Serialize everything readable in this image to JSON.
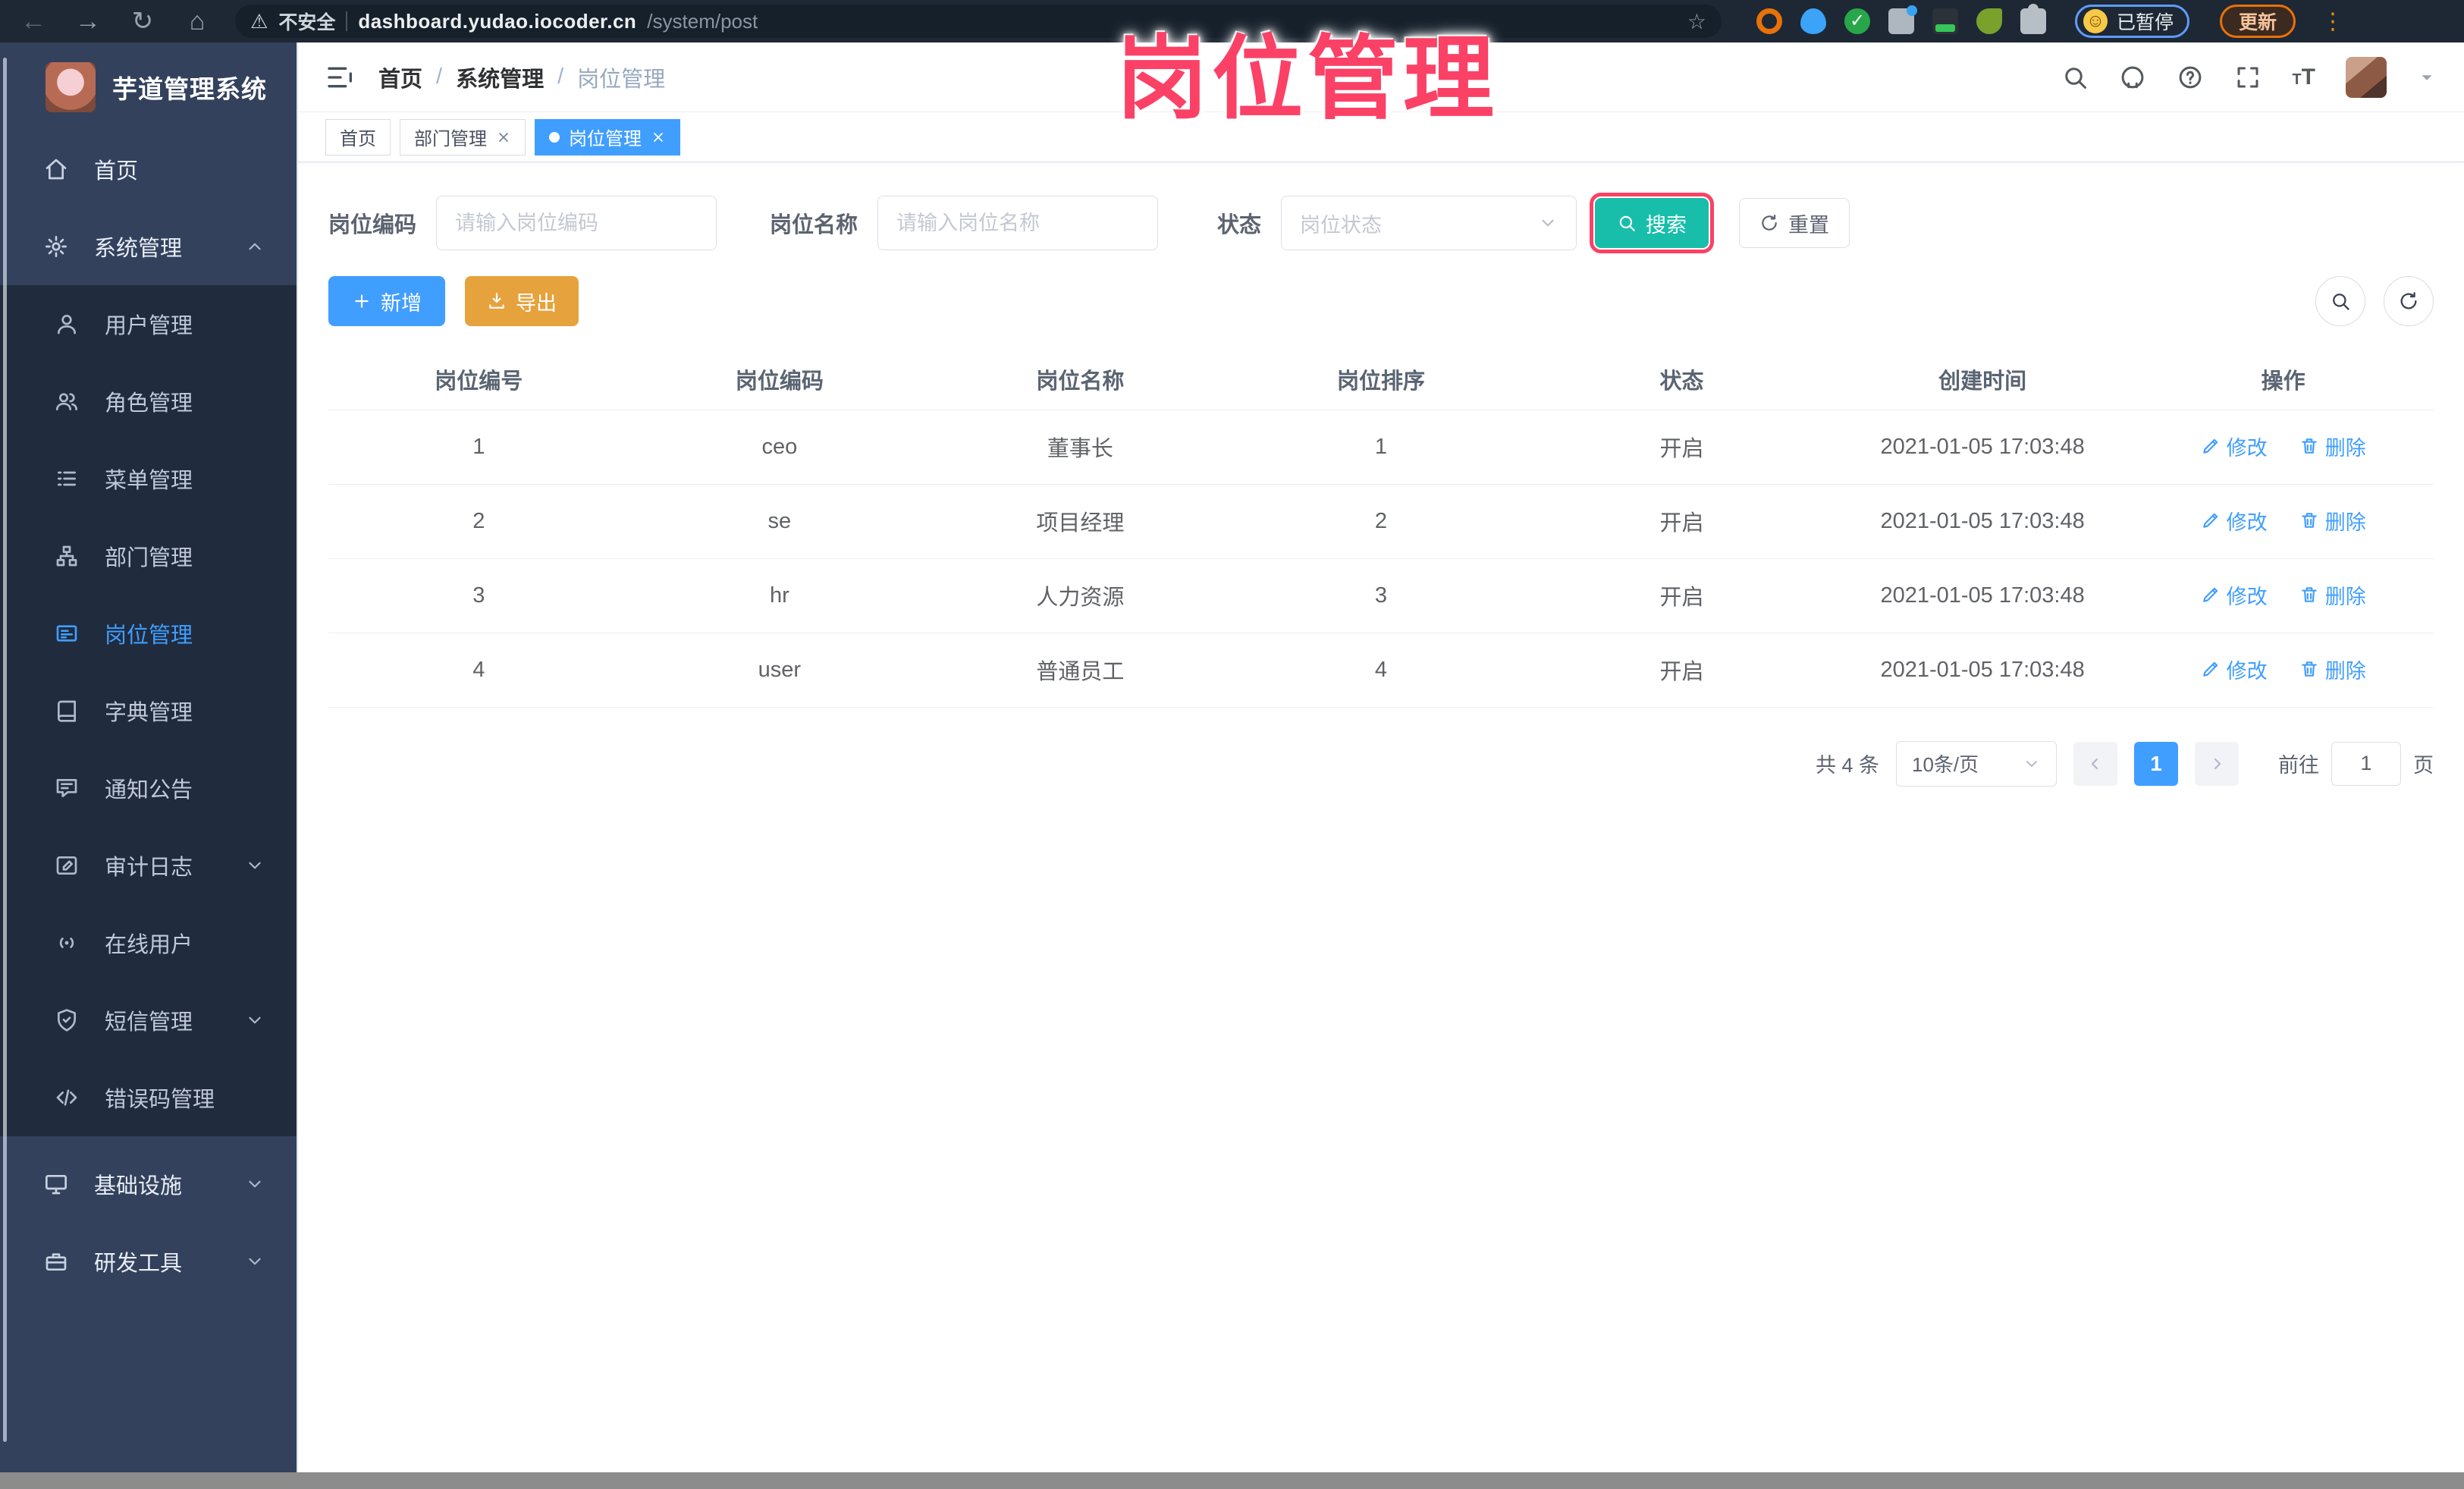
{
  "browser": {
    "security_label": "不安全",
    "url_domain": "dashboard.yudao.iocoder.cn",
    "url_path": "/system/post",
    "paused_badge": "已暂停",
    "update_button": "更新"
  },
  "annotation": {
    "title": "岗位管理"
  },
  "sidebar": {
    "app_title": "芋道管理系统",
    "items": {
      "home": "首页",
      "system": "系统管理",
      "user": "用户管理",
      "role": "角色管理",
      "menu": "菜单管理",
      "dept": "部门管理",
      "post": "岗位管理",
      "dict": "字典管理",
      "notice": "通知公告",
      "audit": "审计日志",
      "online": "在线用户",
      "sms": "短信管理",
      "errcode": "错误码管理",
      "infra": "基础设施",
      "devtool": "研发工具"
    }
  },
  "header": {
    "breadcrumb": [
      "首页",
      "系统管理",
      "岗位管理"
    ]
  },
  "tabs": [
    {
      "label": "首页"
    },
    {
      "label": "部门管理"
    },
    {
      "label": "岗位管理"
    }
  ],
  "filters": {
    "code_label": "岗位编码",
    "code_placeholder": "请输入岗位编码",
    "name_label": "岗位名称",
    "name_placeholder": "请输入岗位名称",
    "status_label": "状态",
    "status_placeholder": "岗位状态",
    "search_button": "搜索",
    "reset_button": "重置"
  },
  "toolbar": {
    "add_button": "新增",
    "export_button": "导出"
  },
  "table": {
    "columns": [
      "岗位编号",
      "岗位编码",
      "岗位名称",
      "岗位排序",
      "状态",
      "创建时间",
      "操作"
    ],
    "edit_label": "修改",
    "delete_label": "删除",
    "rows": [
      {
        "id": "1",
        "code": "ceo",
        "name": "董事长",
        "sort": "1",
        "status": "开启",
        "created": "2021-01-05 17:03:48"
      },
      {
        "id": "2",
        "code": "se",
        "name": "项目经理",
        "sort": "2",
        "status": "开启",
        "created": "2021-01-05 17:03:48"
      },
      {
        "id": "3",
        "code": "hr",
        "name": "人力资源",
        "sort": "3",
        "status": "开启",
        "created": "2021-01-05 17:03:48"
      },
      {
        "id": "4",
        "code": "user",
        "name": "普通员工",
        "sort": "4",
        "status": "开启",
        "created": "2021-01-05 17:03:48"
      }
    ]
  },
  "pagination": {
    "total_label": "共 4 条",
    "page_size": "10条/页",
    "current_page": "1",
    "goto_label": "前往",
    "goto_value": "1",
    "unit_label": "页"
  },
  "icons": {
    "browser": [
      "back-arrow",
      "forward-arrow",
      "reload",
      "home",
      "warning-triangle",
      "star",
      "extensions",
      "kebab-menu"
    ],
    "header": [
      "hamburger",
      "search",
      "github",
      "question-circle",
      "fullscreen",
      "font-size",
      "avatar",
      "caret-down"
    ],
    "sidebar": [
      "home",
      "gear",
      "user",
      "users",
      "list",
      "org-tree",
      "postcard",
      "book",
      "chat-bubble",
      "log-pencil",
      "online-signal",
      "shield",
      "code-brackets",
      "monitor",
      "briefcase"
    ],
    "actions": [
      "plus",
      "download",
      "magnifier",
      "refresh",
      "pencil",
      "trash",
      "chevron",
      "close"
    ]
  },
  "colors": {
    "accent_blue": "#409eff",
    "search_teal": "#18bea9",
    "export_orange": "#e6a23c",
    "annotation_pink": "#fb4166",
    "sidebar_bg": "#33415c",
    "submenu_bg": "#202b3d",
    "chrome_bg": "#1d2834"
  }
}
